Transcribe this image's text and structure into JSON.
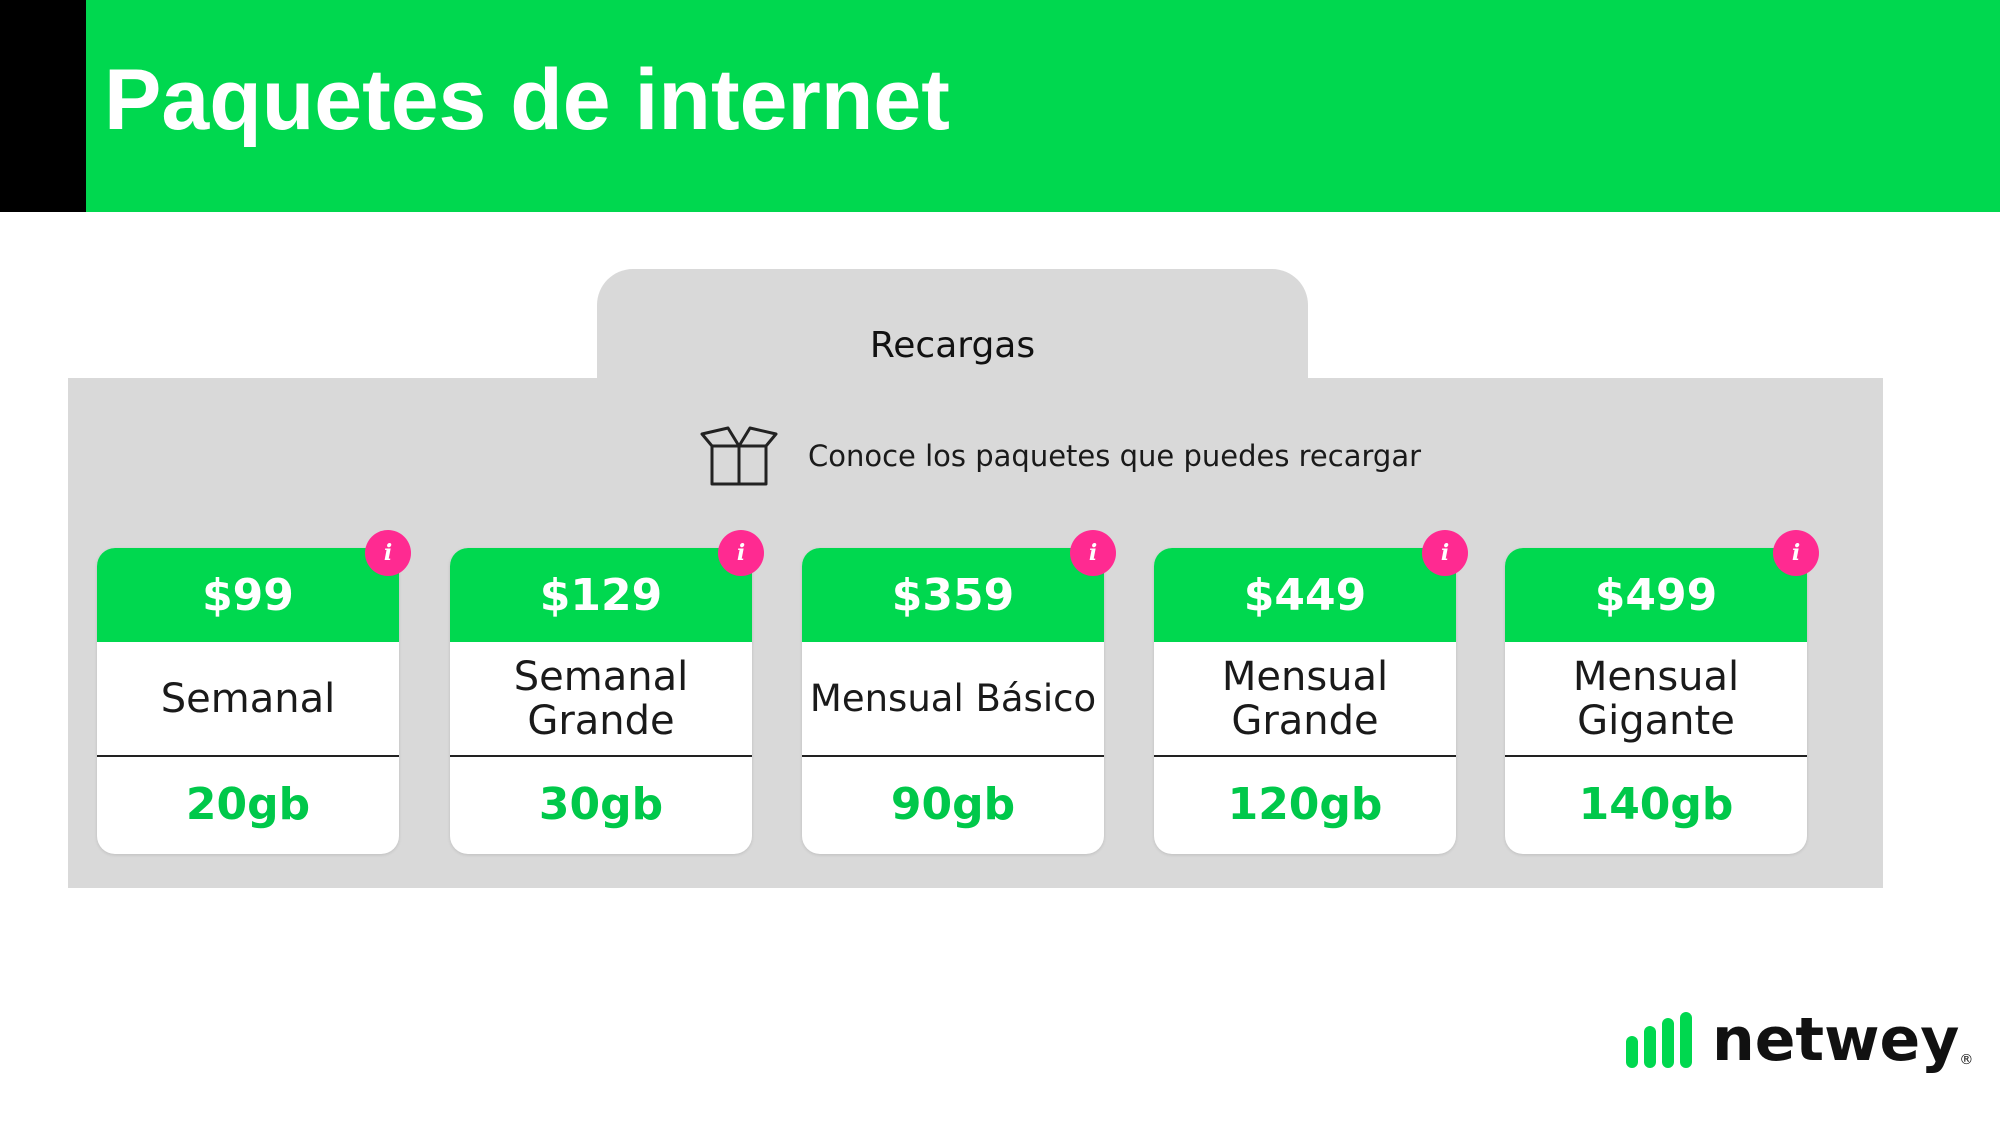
{
  "header": {
    "title": "Paquetes de internet",
    "accent_color": "#000000",
    "bar_color": "#00d84f"
  },
  "tab": {
    "label": "Recargas"
  },
  "panel": {
    "subtitle": "Conoce los paquetes que puedes recargar",
    "subtitle_icon": "box-icon"
  },
  "packages": [
    {
      "price": "$99",
      "name": "Semanal",
      "data": "20gb",
      "info_icon": "i"
    },
    {
      "price": "$129",
      "name": "Semanal Grande",
      "data": "30gb",
      "info_icon": "i"
    },
    {
      "price": "$359",
      "name": "Mensual Básico",
      "data": "90gb",
      "info_icon": "i"
    },
    {
      "price": "$449",
      "name": "Mensual Grande",
      "data": "120gb",
      "info_icon": "i"
    },
    {
      "price": "$499",
      "name": "Mensual Gigante",
      "data": "140gb",
      "info_icon": "i"
    }
  ],
  "colors": {
    "brand_green": "#00d84f",
    "info_pink": "#ff2a91",
    "panel_gray": "#d9d9d9"
  },
  "logo": {
    "text": "netwey",
    "mark": "®"
  }
}
